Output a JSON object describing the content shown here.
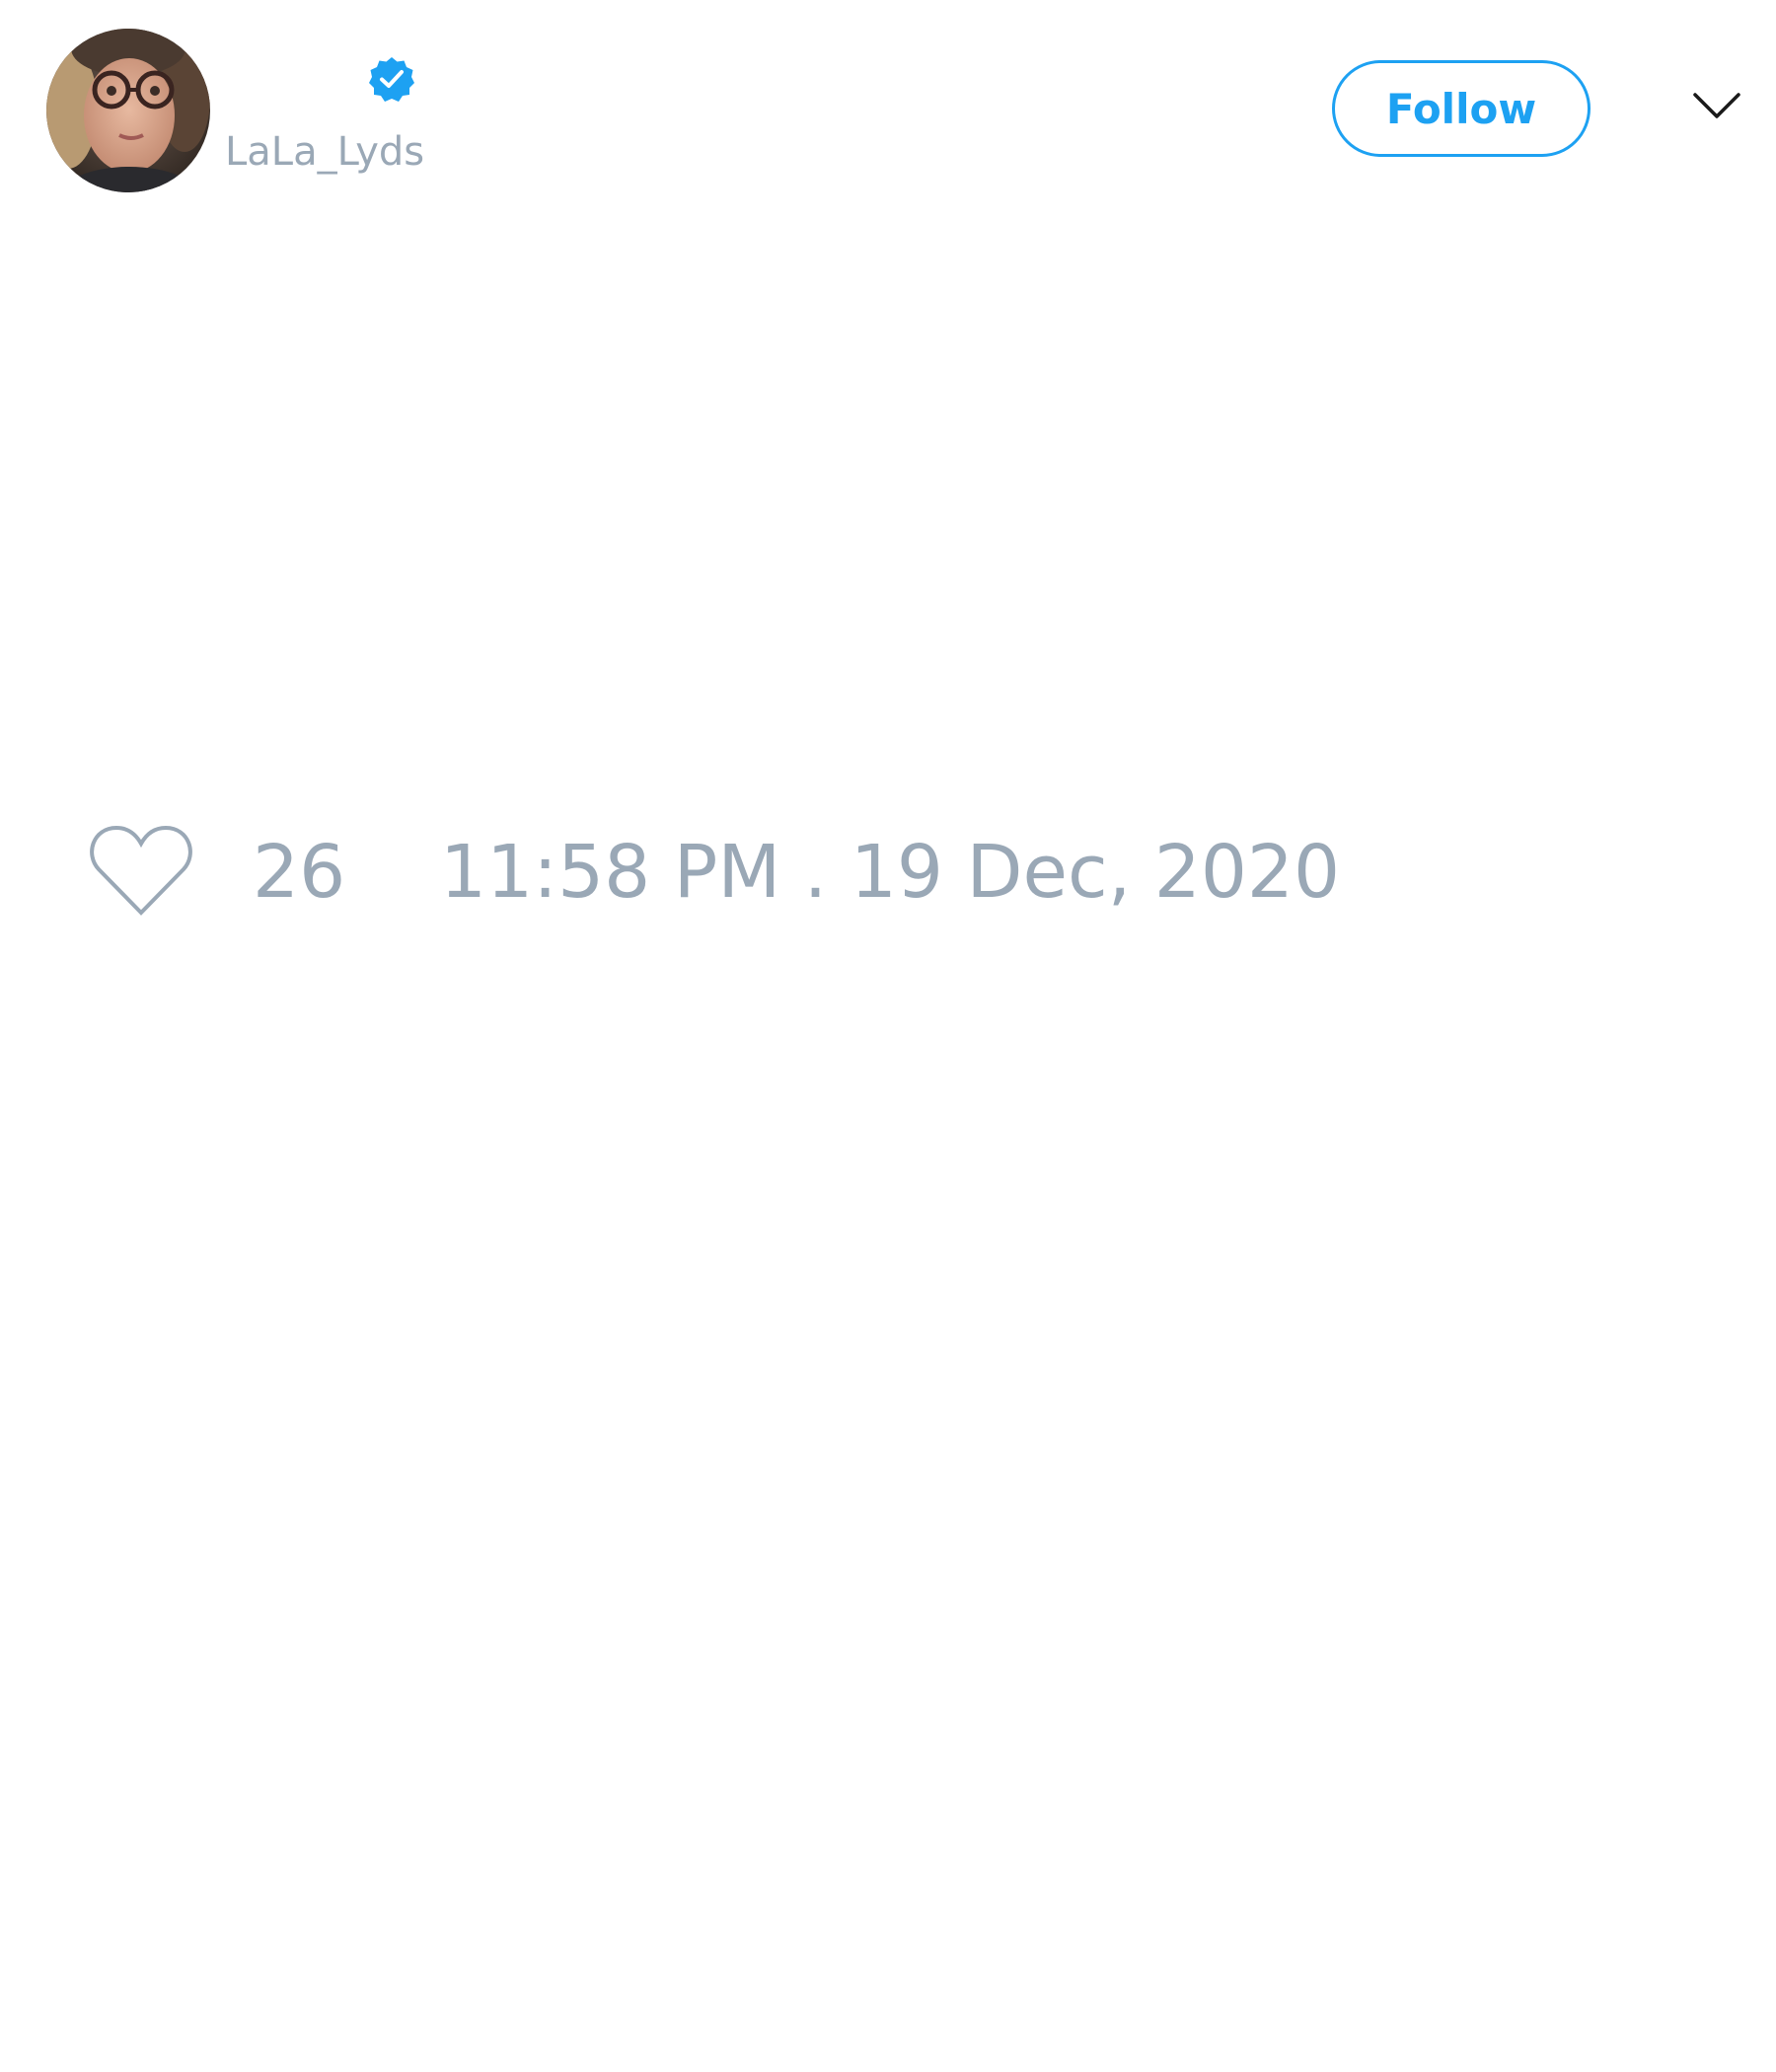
{
  "author": {
    "handle": "LaLa_Lyds",
    "verified": true,
    "avatar_icon": "profile-photo"
  },
  "actions": {
    "follow_label": "Follow",
    "menu_icon": "chevron-down-icon"
  },
  "stats": {
    "like_icon": "heart-outline-icon",
    "like_count": "26",
    "timestamp": "11:58 PM . 19 Dec, 2020"
  },
  "colors": {
    "accent": "#1da1f2",
    "muted_text": "#9aa8b6",
    "background": "#ffffff"
  }
}
